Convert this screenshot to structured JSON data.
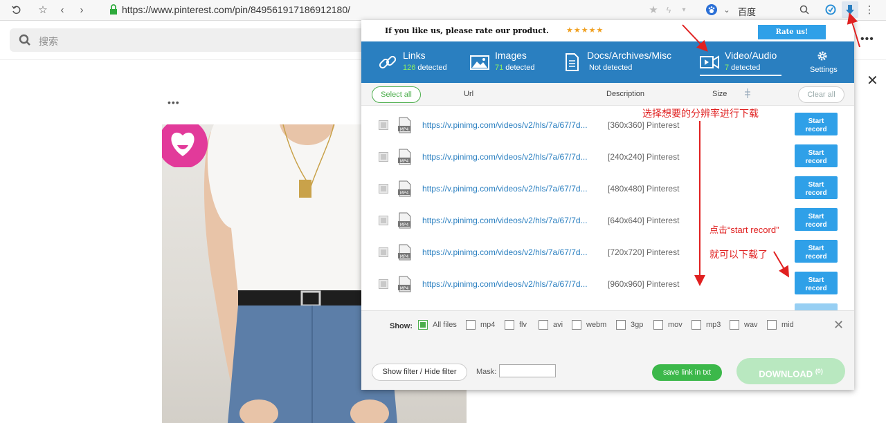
{
  "browser": {
    "url": "https://www.pinterest.com/pin/849561917186912180/",
    "search_engine": "百度",
    "icons": [
      "undo-icon",
      "star-icon",
      "back-arrow-icon",
      "forward-arrow-icon",
      "lock-icon",
      "bookmark-star-icon",
      "lightning-icon",
      "paw-icon",
      "search-icon",
      "extension-icon",
      "downloader-extension-icon",
      "menu-dots-icon"
    ]
  },
  "pinterest": {
    "search_placeholder": "搜索",
    "more_dots": "•••",
    "right_dots": "•••",
    "close": "✕"
  },
  "extension": {
    "rate_text": "If you like us, please rate our product.",
    "stars": "★★★★★",
    "rate_button": "Rate us!",
    "tabs": [
      {
        "label": "Links",
        "count": "126",
        "status": "detected",
        "icon": "link-icon"
      },
      {
        "label": "Images",
        "count": "71",
        "status": "detected",
        "icon": "image-icon"
      },
      {
        "label": "Docs/Archives/Misc",
        "count": "",
        "status": "Not detected",
        "icon": "document-icon"
      },
      {
        "label": "Video/Audio",
        "count": "7",
        "status": "detected",
        "icon": "video-icon"
      }
    ],
    "settings_label": "Settings",
    "columns": {
      "select_all": "Select all",
      "url": "Url",
      "description": "Description",
      "size": "Size",
      "clear_all": "Clear all"
    },
    "rows": [
      {
        "type": "MP4",
        "url": "https://v.pinimg.com/videos/v2/hls/7a/67/7d...",
        "description": "[360x360] Pinterest",
        "button": "Start record"
      },
      {
        "type": "MP4",
        "url": "https://v.pinimg.com/videos/v2/hls/7a/67/7d...",
        "description": "[240x240] Pinterest",
        "button": "Start record"
      },
      {
        "type": "MP4",
        "url": "https://v.pinimg.com/videos/v2/hls/7a/67/7d...",
        "description": "[480x480] Pinterest",
        "button": "Start record"
      },
      {
        "type": "MP4",
        "url": "https://v.pinimg.com/videos/v2/hls/7a/67/7d...",
        "description": "[640x640] Pinterest",
        "button": "Start record"
      },
      {
        "type": "MP4",
        "url": "https://v.pinimg.com/videos/v2/hls/7a/67/7d...",
        "description": "[720x720] Pinterest",
        "button": "Start record"
      },
      {
        "type": "MP4",
        "url": "https://v.pinimg.com/videos/v2/hls/7a/67/7d...",
        "description": "[960x960] Pinterest",
        "button": "Start record"
      }
    ],
    "filter": {
      "show_label": "Show:",
      "types": [
        {
          "label": "All files",
          "checked": true
        },
        {
          "label": "mp4",
          "checked": false
        },
        {
          "label": "flv",
          "checked": false
        },
        {
          "label": "avi",
          "checked": false
        },
        {
          "label": "webm",
          "checked": false
        },
        {
          "label": "3gp",
          "checked": false
        },
        {
          "label": "mov",
          "checked": false
        },
        {
          "label": "mp3",
          "checked": false
        },
        {
          "label": "wav",
          "checked": false
        },
        {
          "label": "mid",
          "checked": false
        }
      ],
      "close": "✕"
    },
    "footer": {
      "filter_button": "Show filter / Hide filter",
      "mask_label": "Mask:",
      "mask_value": "",
      "save_button": "save link in txt",
      "download_label": "DOWNLOAD",
      "download_count": "(0)"
    }
  },
  "annotations": {
    "resolution_note": "选择想要的分辨率进行下载",
    "click_note": "点击“start record”",
    "download_note": "就可以下载了",
    "color": "#e02020"
  },
  "colors": {
    "tab_bar": "#2a7fc0",
    "accent_blue": "#2fa0e8",
    "accent_green": "#4cae4c",
    "count_green": "#8ef060"
  }
}
